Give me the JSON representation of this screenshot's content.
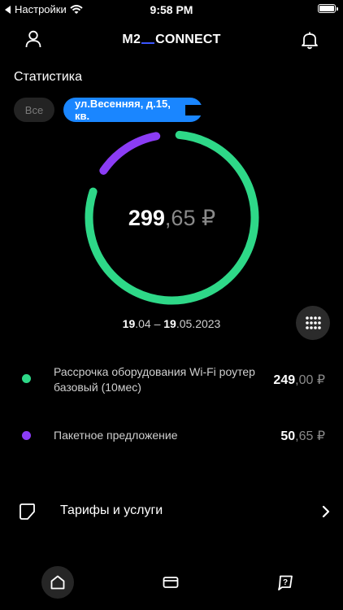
{
  "status_bar": {
    "back_label": "Настройки",
    "time": "9:58 PM"
  },
  "header": {
    "logo_left": "M2",
    "logo_right": "CONNECT"
  },
  "stats": {
    "title": "Статистика",
    "filters": [
      {
        "label": "Все",
        "selected": false
      },
      {
        "label": "ул.Весенняя, д.15, кв.",
        "selected": true
      }
    ],
    "total": {
      "integer": "299",
      "fraction": ",65 ₽"
    },
    "period": {
      "start_day": "19",
      "start_rest": ".04 – ",
      "end_day": "19",
      "end_rest": ".05.2023"
    },
    "items": [
      {
        "label": "Рассрочка оборудования Wi-Fi роутер базовый (10мес)",
        "integer": "249",
        "fraction": ",00 ₽",
        "value": 249.0,
        "color": "#2ed888"
      },
      {
        "label": "Пакетное предложение",
        "integer": "50",
        "fraction": ",65 ₽",
        "value": 50.65,
        "color": "#8b3cf5"
      }
    ]
  },
  "menu": {
    "tariffs_label": "Тарифы и услуги"
  },
  "colors": {
    "accent": "#1a86ff",
    "green": "#2ed888",
    "purple": "#8b3cf5"
  }
}
